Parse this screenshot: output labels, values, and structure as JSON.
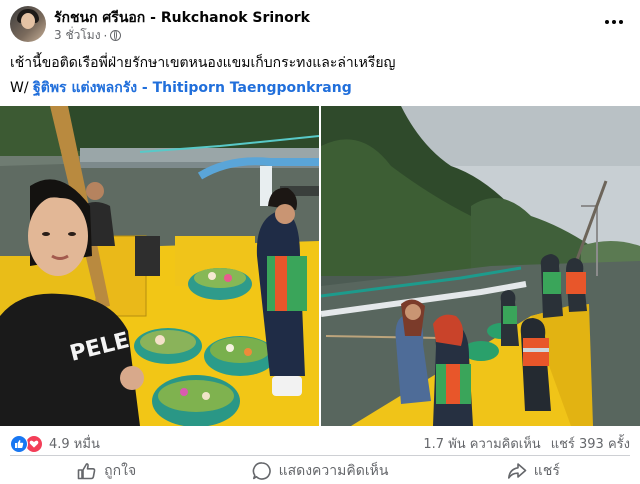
{
  "post": {
    "author": "รักชนก ศรีนอก - Rukchanok Srinork",
    "time": "3 ชั่วโมง",
    "privacy_icon": "globe-icon",
    "more_icon": "more-dots-icon",
    "text": "เช้านี้ขอติดเรือพี่ฝ่ายรักษาเขตหนองแขมเก็บกระทงและล่าเหรียญ",
    "tag_prefix": "W/",
    "tag_link": "ฐิติพร แต่งพลกรัง - Thitiporn Taengponkrang"
  },
  "stats": {
    "reaction_icons": [
      "like-icon",
      "love-icon"
    ],
    "reaction_count": "4.9 หมื่น",
    "comments": "1.7 พัน ความคิดเห็น",
    "shares": "แชร์ 393 ครั้ง"
  },
  "actions": {
    "like": "ถูกใจ",
    "comment": "แสดงความคิดเห็น",
    "share": "แชร์"
  },
  "colors": {
    "link": "#216fdb",
    "secondary_text": "#65676b",
    "like_blue": "#1877f2",
    "love_red": "#f33e58",
    "boat_yellow": "#f2c616"
  },
  "photos": {
    "left_shirt_text": "PELE"
  }
}
